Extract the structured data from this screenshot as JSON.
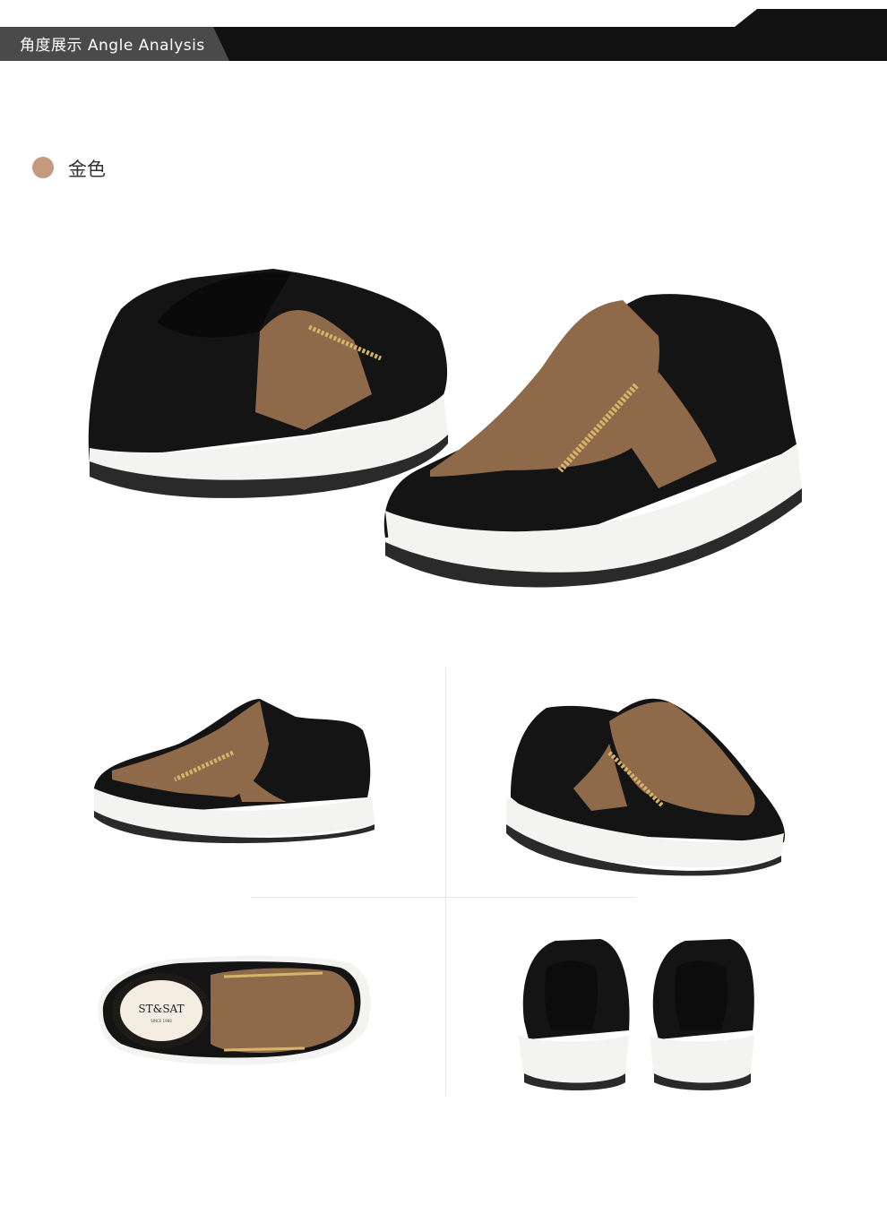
{
  "header": {
    "title": "角度展示  Angle Analysis"
  },
  "color_option": {
    "label": "金色",
    "swatch_color": "#c39a7e"
  },
  "insole_brand": {
    "text": "ST&SAT",
    "subtext": "SINCE 1988"
  },
  "photos": [
    {
      "view": "hero pair"
    },
    {
      "view": "side outer"
    },
    {
      "view": "three-quarter front"
    },
    {
      "view": "top"
    },
    {
      "view": "back pair"
    }
  ],
  "colors": {
    "banner_dark": "#111111",
    "banner_grey": "#4a4a4a",
    "leather": "#141414",
    "metallic": "#8f6a4a",
    "sole": "#f3f3f1",
    "outsole": "#2a2a2a",
    "zipper": "#d8b36a"
  }
}
